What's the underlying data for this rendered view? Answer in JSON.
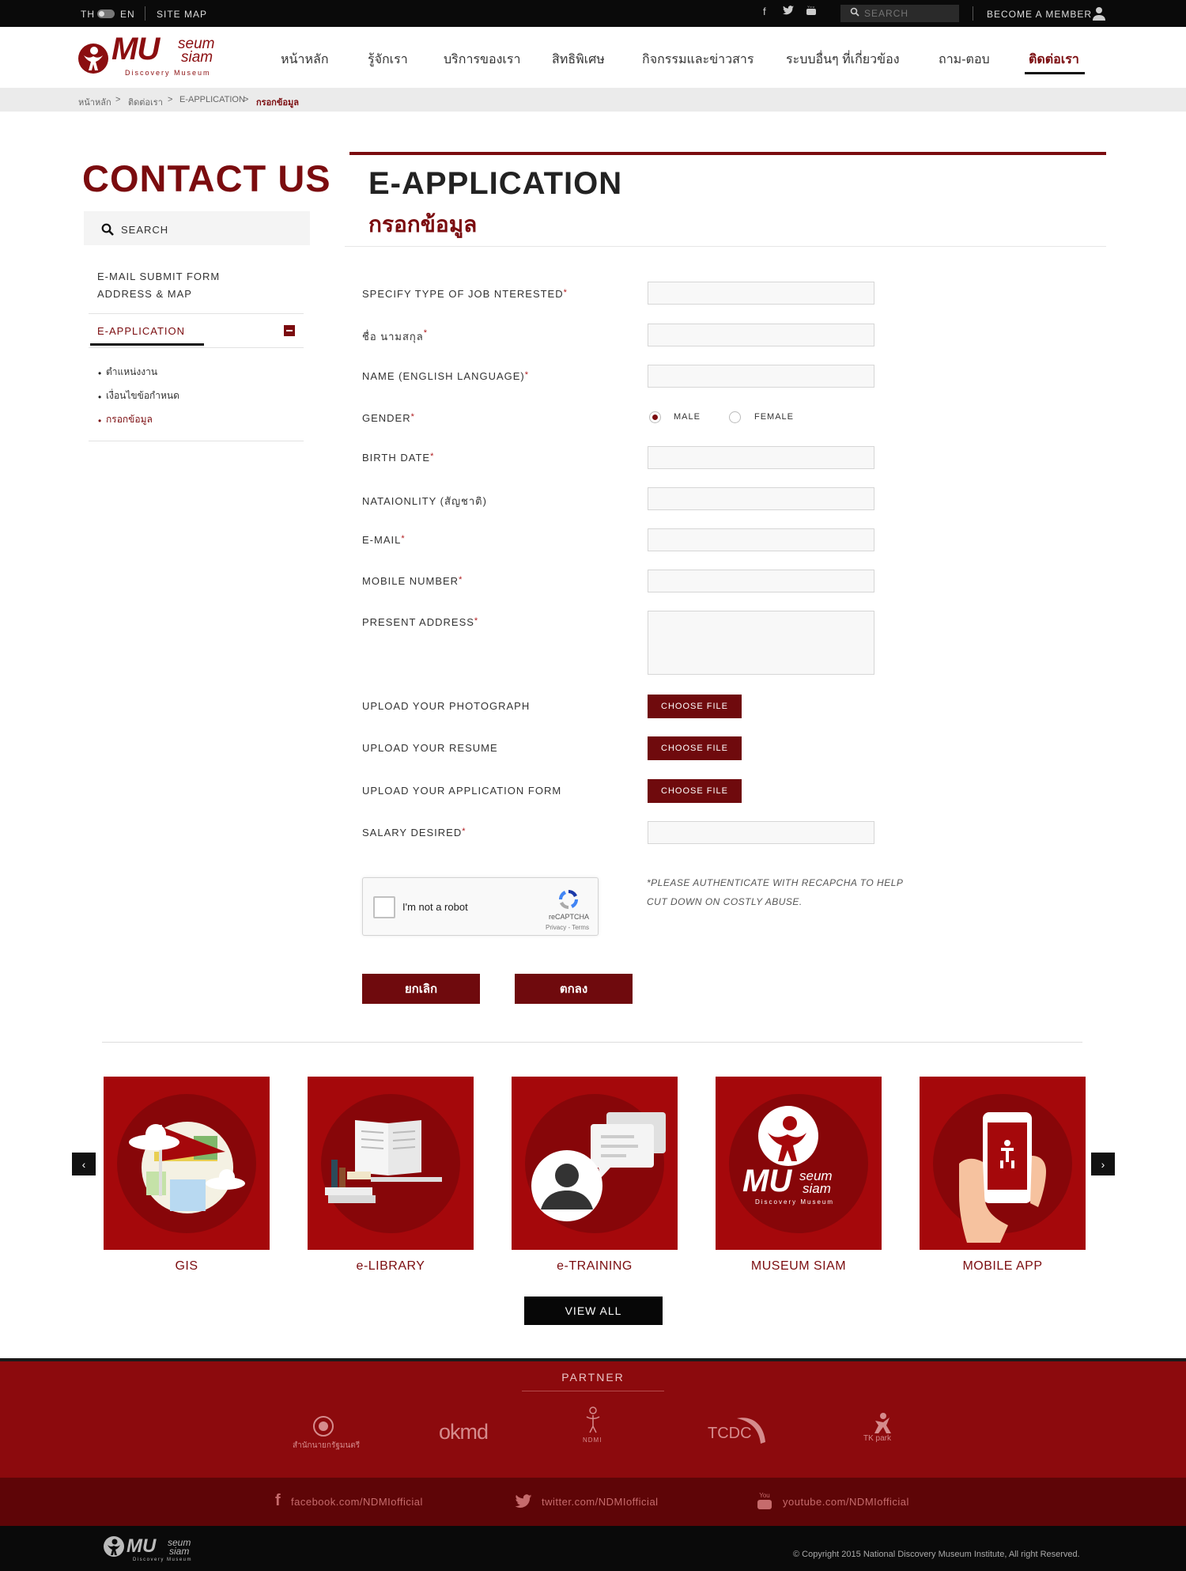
{
  "topbar": {
    "lang_th": "TH",
    "lang_en": "EN",
    "site_map": "SITE MAP",
    "search_placeholder": "SEARCH",
    "become_member": "BECOME A MEMBER",
    "social_icons": [
      "facebook-icon",
      "twitter-icon",
      "youtube-icon"
    ]
  },
  "logo": {
    "mu": "MU",
    "seum": "seum",
    "siam": "siam",
    "tagline": "Discovery Museum"
  },
  "nav": {
    "items": [
      "หน้าหลัก",
      "รู้จักเรา",
      "บริการของเรา",
      "สิทธิพิเศษ",
      "กิจกรรมและข่าวสาร",
      "ระบบอื่นๆ ที่เกี่ยวข้อง",
      "ถาม-ตอบ",
      "ติดต่อเรา"
    ],
    "active_index": 7
  },
  "breadcrumb": {
    "items": [
      "หน้าหลัก",
      "ติดต่อเรา",
      "E-APPLICATION",
      "กรอกข้อมูล"
    ],
    "separator": ">"
  },
  "sidebar": {
    "title": "CONTACT US",
    "search_label": "SEARCH",
    "links": [
      "E-MAIL SUBMIT FORM",
      "ADDRESS & MAP"
    ],
    "active_section": "E-APPLICATION",
    "sub_items": [
      "ตำแหน่งงาน",
      "เงื่อนไขข้อกำหนด",
      "กรอกข้อมูล"
    ],
    "active_sub_index": 2
  },
  "main": {
    "title": "E-APPLICATION",
    "subtitle": "กรอกข้อมูล"
  },
  "form": {
    "required_mark": "*",
    "labels": {
      "job_type": "SPECIFY TYPE OF JOB NTERESTED",
      "thai_name": "ชื่อ นามสกุล",
      "english_name": "NAME (ENGLISH LANGUAGE)",
      "gender": "GENDER",
      "birth_date": "BIRTH DATE",
      "nationality": "NATAIONLITY (สัญชาติ)",
      "email": "E-MAIL",
      "mobile": "MOBILE NUMBER",
      "address": "PRESENT ADDRESS",
      "photo": "UPLOAD YOUR PHOTOGRAPH",
      "resume": "UPLOAD YOUR RESUME",
      "application_form": "UPLOAD YOUR APPLICATION FORM",
      "salary": "SALARY DESIRED"
    },
    "values": {
      "job_type": "",
      "thai_name": "",
      "english_name": "",
      "birth_date": "",
      "nationality": "",
      "email": "",
      "mobile": "",
      "address": "",
      "salary": ""
    },
    "gender_options": [
      "MALE",
      "FEMALE"
    ],
    "gender_selected": "MALE",
    "choose_file_label": "CHOOSE FILE",
    "captcha": {
      "label": "I'm not a robot",
      "brand": "reCAPTCHA",
      "links": "Privacy - Terms",
      "checked": false
    },
    "captcha_note": "*PLEASE AUTHENTICATE WITH RECAPCHA TO HELP CUT DOWN ON COSTLY ABUSE.",
    "cancel_label": "ยกเลิก",
    "submit_label": "ตกลง"
  },
  "services": {
    "items": [
      "GIS",
      "e-LIBRARY",
      "e-TRAINING",
      "MUSEUM SIAM",
      "MOBILE APP"
    ],
    "view_all": "VIEW ALL"
  },
  "footer": {
    "partner_title": "PARTNER",
    "partners": [
      "สำนักนายกรัฐมนตรี",
      "okmd",
      "NDMI",
      "TCDC",
      "TK park"
    ],
    "social": [
      "facebook.com/NDMIofficial",
      "twitter.com/NDMIofficial",
      "youtube.com/NDMIofficial"
    ],
    "copyright": "© Copyright 2015 National Discovery Museum Institute, All right Reserved."
  },
  "colors": {
    "brand_red": "#7b0c0f",
    "tile_red": "#a5080b",
    "footer_red": "#8c0a0d",
    "footer_dark_red": "#5e0507",
    "black": "#0a0a0a"
  }
}
